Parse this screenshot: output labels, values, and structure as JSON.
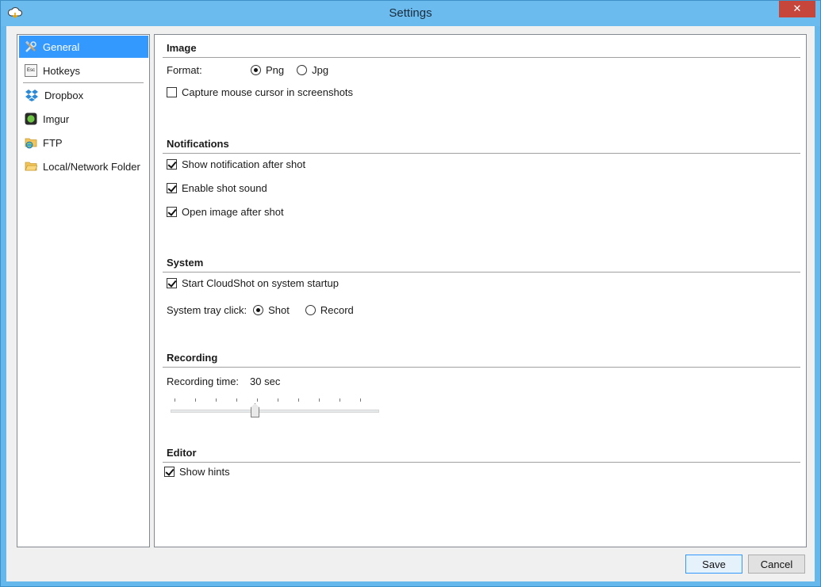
{
  "window": {
    "title": "Settings",
    "close_label": "✕"
  },
  "sidebar": {
    "items": [
      {
        "label": "General",
        "icon": "tools-icon",
        "selected": true
      },
      {
        "label": "Hotkeys",
        "icon": "keyboard-key-icon"
      },
      {
        "label": "Dropbox",
        "icon": "dropbox-icon"
      },
      {
        "label": "Imgur",
        "icon": "imgur-icon"
      },
      {
        "label": "FTP",
        "icon": "ftp-folder-icon"
      },
      {
        "label": "Local/Network Folder",
        "icon": "folder-icon"
      }
    ],
    "hotkeys_icon_text": "Esc"
  },
  "image": {
    "title": "Image",
    "format_label": "Format:",
    "format_png": "Png",
    "format_jpg": "Jpg",
    "format_selected": "Png",
    "capture_cursor_label": "Capture mouse cursor in screenshots",
    "capture_cursor_checked": false
  },
  "notifications": {
    "title": "Notifications",
    "show_notification_label": "Show notification after shot",
    "show_notification_checked": true,
    "enable_sound_label": "Enable shot sound",
    "enable_sound_checked": true,
    "open_image_label": "Open image after shot",
    "open_image_checked": true
  },
  "system": {
    "title": "System",
    "startup_label": "Start CloudShot on system startup",
    "startup_checked": true,
    "tray_click_label": "System tray click:",
    "tray_shot": "Shot",
    "tray_record": "Record",
    "tray_selected": "Shot"
  },
  "recording": {
    "title": "Recording",
    "time_label": "Recording time:",
    "time_value": "30 sec",
    "slider_fraction": 0.4
  },
  "editor": {
    "title": "Editor",
    "show_hints_label": "Show hints",
    "show_hints_checked": true
  },
  "buttons": {
    "save": "Save",
    "cancel": "Cancel"
  },
  "colors": {
    "titlebar": "#6bbbee",
    "selection": "#3399ff",
    "close": "#c7463c"
  }
}
